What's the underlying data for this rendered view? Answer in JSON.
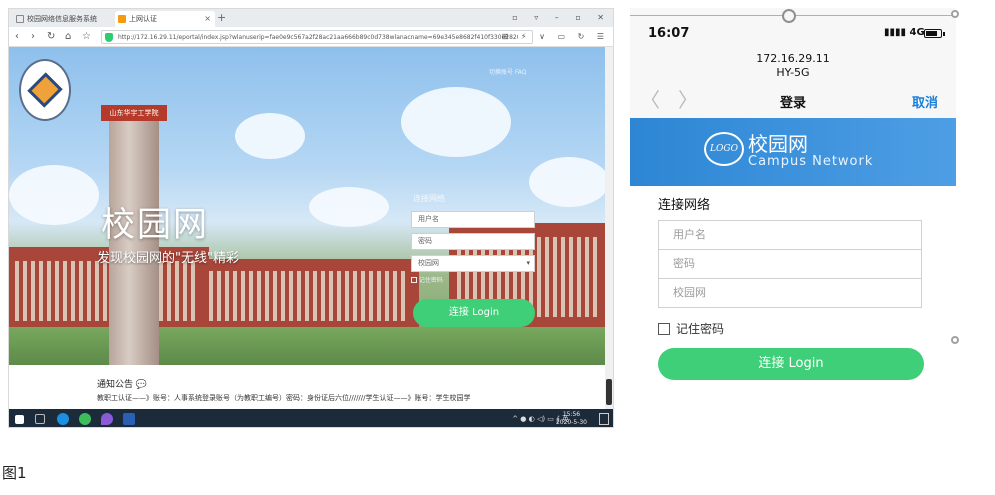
{
  "desktop": {
    "tabs": [
      {
        "label": "校园网络信息服务系统"
      },
      {
        "label": "上网认证"
      }
    ],
    "new_tab": "+",
    "window_controls": "▫ ▿ – ▫ ✕",
    "url": "http://172.16.29.11/eportal/index.jsp?wlanuserip=fae0e9c567a2f28ac21aa666b89c0d738wlanacname=69e345e8682f410f330e2820126a",
    "nav_right": "⊞ ⚡ ∨ ▭ ↻ ☰",
    "top_links": "切换账号  FAQ",
    "campus_title": "校园网",
    "campus_subtitle": "发现校园网的\"无线\"精彩",
    "tower_sign": "山东华宇工学院",
    "login_label": "连接网络",
    "username_placeholder": "用户名",
    "password_placeholder": "密码",
    "network_select": "校园网",
    "remember": "记住密码",
    "connect_button": "连接 Login",
    "notice_title": "通知公告",
    "notice_text": "教职工认证——》账号：人事系统登录账号（为教职工编号）密码：身份证后六位///////学生认证——》账号：学生校园学",
    "tray_text": "^ ● ◐ ◁) ▭ ∮ 英",
    "clock_time": "15:56",
    "clock_date": "2020-5-30"
  },
  "phone": {
    "time": "16:07",
    "signal": "▮▮▮▮ 4G",
    "ip": "172.16.29.11",
    "ssid": "HY-5G",
    "back": "〈",
    "forward": "〉",
    "title": "登录",
    "cancel": "取消",
    "logo_text": "LOGO",
    "brand": "校园网",
    "brand_en": "Campus Network",
    "section_title": "连接网络",
    "username_placeholder": "用户名",
    "password_placeholder": "密码",
    "network_field": "校园网",
    "remember": "记住密码",
    "connect_button": "连接 Login"
  },
  "caption": "图1",
  "colors": {
    "login_green": "#3fcf78",
    "cancel_blue": "#1b7fd8",
    "banner_blue": "#2d86d4"
  }
}
